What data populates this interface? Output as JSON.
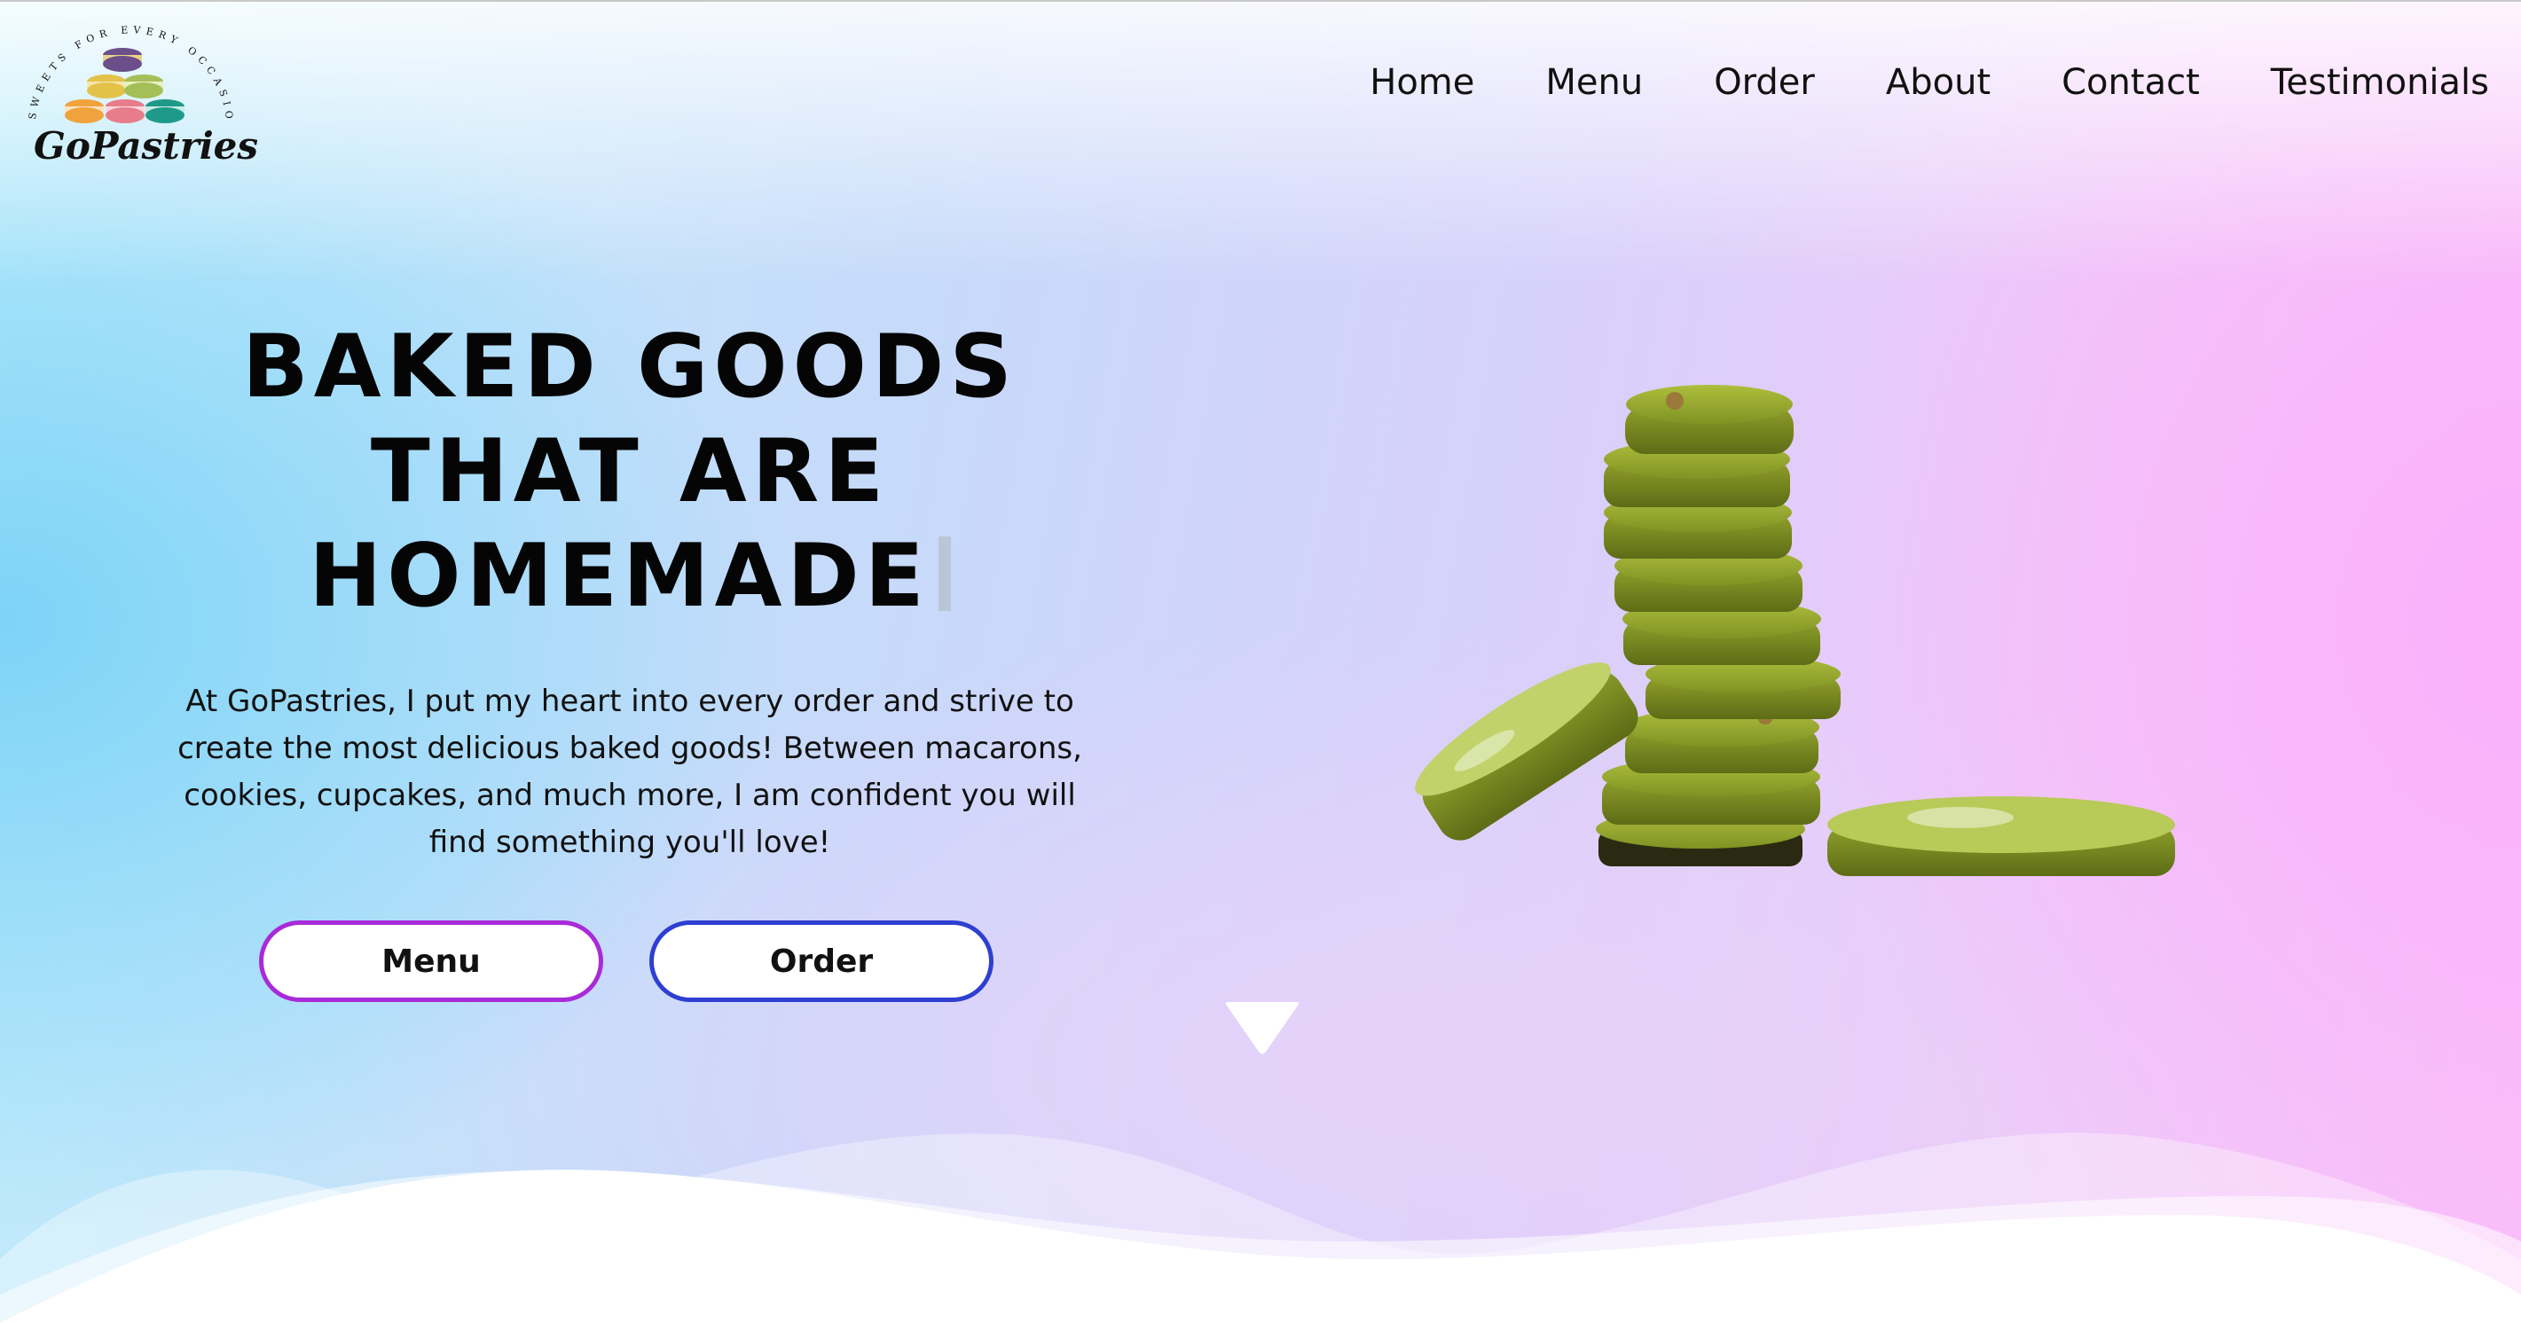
{
  "logo": {
    "brand": "GoPastries",
    "tagline": "SWEETS FOR EVERY OCCASION"
  },
  "nav": {
    "items": [
      "Home",
      "Menu",
      "Order",
      "About",
      "Contact",
      "Testimonials"
    ]
  },
  "hero": {
    "title_lines": [
      "BAKED GOODS",
      "THAT ARE",
      "HOMEMADE"
    ],
    "description": "At GoPastries, I put my heart into every order and strive to create the most delicious baked goods! Between macarons, cookies, cupcakes, and much more, I am confident you will find something you'll love!",
    "buttons": {
      "menu": "Menu",
      "order": "Order"
    }
  },
  "icons": {
    "scroll": "chevron-down-icon",
    "hero_image": "matcha-cookies-image"
  },
  "colors": {
    "menu_button_border": "#a92ad8",
    "order_button_border": "#2e3fd1",
    "bg_left": "#7dd3f7",
    "bg_right": "#fbb0fb"
  }
}
